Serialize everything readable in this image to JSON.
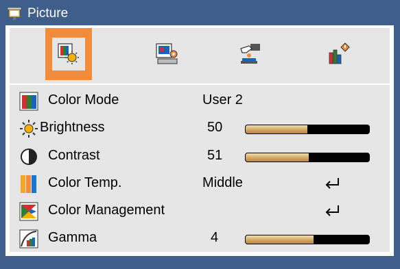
{
  "window": {
    "title": "Picture"
  },
  "tabs": [
    {
      "name": "picture",
      "icon": "picture-brightness-icon",
      "active": true
    },
    {
      "name": "image",
      "icon": "image-settings-icon",
      "active": false
    },
    {
      "name": "management",
      "icon": "management-hand-icon",
      "active": false
    },
    {
      "name": "information",
      "icon": "info-chart-icon",
      "active": false
    }
  ],
  "settings": [
    {
      "label": "Color Mode",
      "icon": "color-mode-icon",
      "value": "User 2"
    },
    {
      "label": "Brightness",
      "icon": "sun-icon",
      "value": "50",
      "level_percent": 50
    },
    {
      "label": "Contrast",
      "icon": "contrast-icon",
      "value": "51",
      "level_percent": 51
    },
    {
      "label": "Color Temp.",
      "icon": "color-temp-icon",
      "value": "Middle",
      "action": "enter-icon"
    },
    {
      "label": "Color Management",
      "icon": "color-management-icon",
      "value": "",
      "action": "enter-icon"
    },
    {
      "label": "Gamma",
      "icon": "gamma-icon",
      "value": "4",
      "level_percent": 55
    }
  ],
  "colors": {
    "background": "#3f5f8a",
    "panel": "#e6e6e6",
    "active_tab": "#f08c3c",
    "bar_fill": "#c99a52",
    "bar_track": "#000000"
  }
}
